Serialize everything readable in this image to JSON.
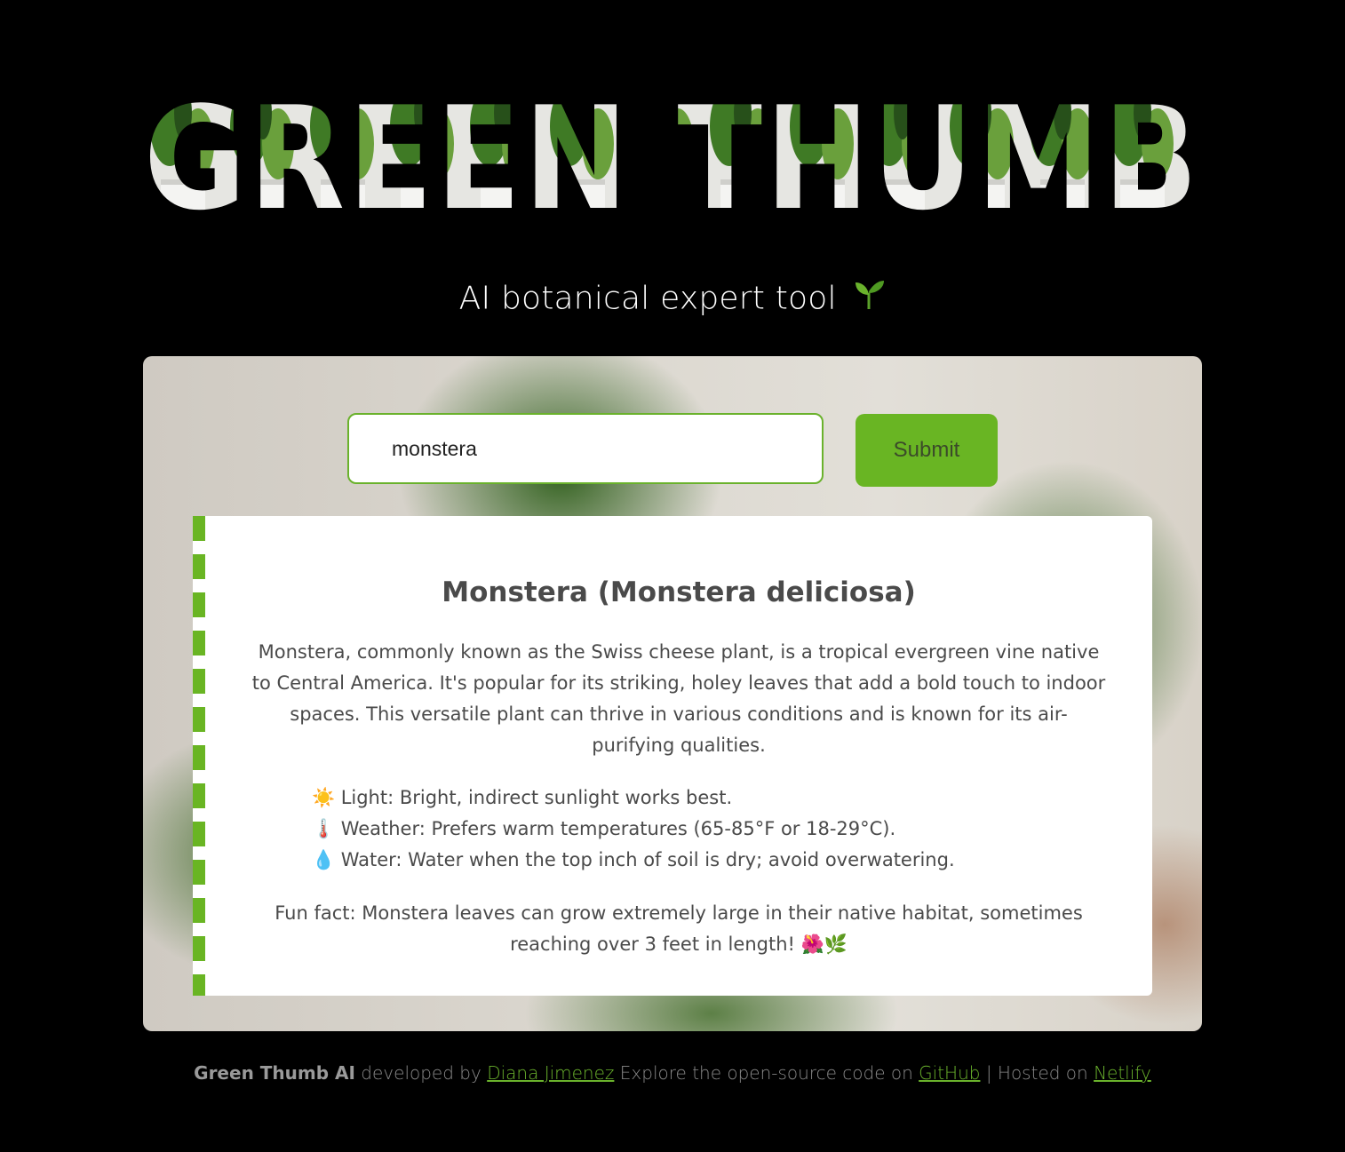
{
  "header": {
    "title": "GREEN THUMB",
    "subtitle": "AI botanical expert tool",
    "subtitle_icon": "sprout-icon"
  },
  "search": {
    "value": "monstera",
    "placeholder": "",
    "submit_label": "Submit"
  },
  "result": {
    "title": "Monstera (Monstera deliciosa)",
    "description": "Monstera, commonly known as the Swiss cheese plant, is a tropical evergreen vine native to Central America. It's popular for its striking, holey leaves that add a bold touch to indoor spaces. This versatile plant can thrive in various conditions and is known for its air-purifying qualities.",
    "care": [
      {
        "icon": "☀️",
        "icon_name": "sun-icon",
        "text": "Light: Bright, indirect sunlight works best."
      },
      {
        "icon": "🌡️",
        "icon_name": "thermometer-icon",
        "text": "Weather: Prefers warm temperatures (65-85°F or 18-29°C)."
      },
      {
        "icon": "💧",
        "icon_name": "droplet-icon",
        "text": "Water: Water when the top inch of soil is dry; avoid overwatering."
      }
    ],
    "fun_fact": "Fun fact: Monstera leaves can grow extremely large in their native habitat, sometimes reaching over 3 feet in length! 🌺🌿"
  },
  "footer": {
    "brand": "Green Thumb AI",
    "developed_by": "developed by",
    "author": "Diana Jimenez",
    "explore": "Explore the open-source code on",
    "github": "GitHub",
    "separator": "| Hosted on",
    "host": "Netlify"
  },
  "colors": {
    "accent": "#69b523",
    "background": "#000000",
    "text": "#4a4a4a"
  }
}
